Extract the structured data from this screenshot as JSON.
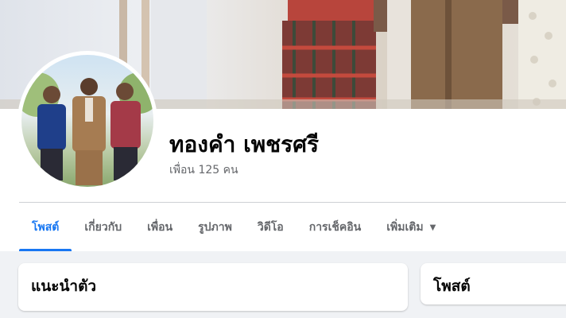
{
  "profile": {
    "name": "ทองคำ เพชรศรี",
    "friends_count": "เพื่อน 125 คน"
  },
  "tabs": [
    {
      "label": "โพสต์",
      "active": true
    },
    {
      "label": "เกี่ยวกับ",
      "active": false
    },
    {
      "label": "เพื่อน",
      "active": false
    },
    {
      "label": "รูปภาพ",
      "active": false
    },
    {
      "label": "วิดีโอ",
      "active": false
    },
    {
      "label": "การเช็คอิน",
      "active": false
    },
    {
      "label": "เพิ่มเติม",
      "active": false,
      "icon": "caret-down-icon"
    }
  ],
  "cards": {
    "intro_title": "แนะนำตัว",
    "posts_title": "โพสต์"
  },
  "colors": {
    "accent": "#1877f2",
    "text_primary": "#050505",
    "text_secondary": "#65676b",
    "background": "#f0f2f5"
  }
}
